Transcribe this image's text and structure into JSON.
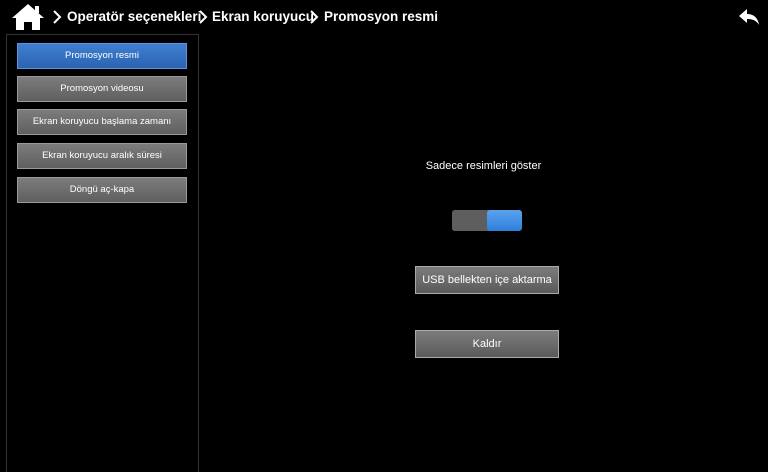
{
  "header": {
    "home_icon": "home-icon",
    "breadcrumbs": [
      "Operatör seçenekleri",
      "Ekran koruyucu",
      "Promosyon resmi"
    ],
    "back_icon": "back-arrow-icon"
  },
  "sidebar": {
    "items": [
      {
        "label": "Promosyon resmi",
        "active": true
      },
      {
        "label": "Promosyon videosu",
        "active": false
      },
      {
        "label": "Ekran koruyucu başlama zamanı",
        "active": false
      },
      {
        "label": "Ekran koruyucu aralık süresi",
        "active": false
      },
      {
        "label": "Döngü aç-kapa",
        "active": false
      }
    ]
  },
  "main": {
    "toggle_label": "Sadece resimleri göster",
    "toggle_on": true,
    "import_button": "USB bellekten içe aktarma",
    "remove_button": "Kaldır"
  },
  "colors": {
    "accent": "#2f7fdc",
    "button_gray": "#6b6b6b",
    "background": "#000000"
  }
}
